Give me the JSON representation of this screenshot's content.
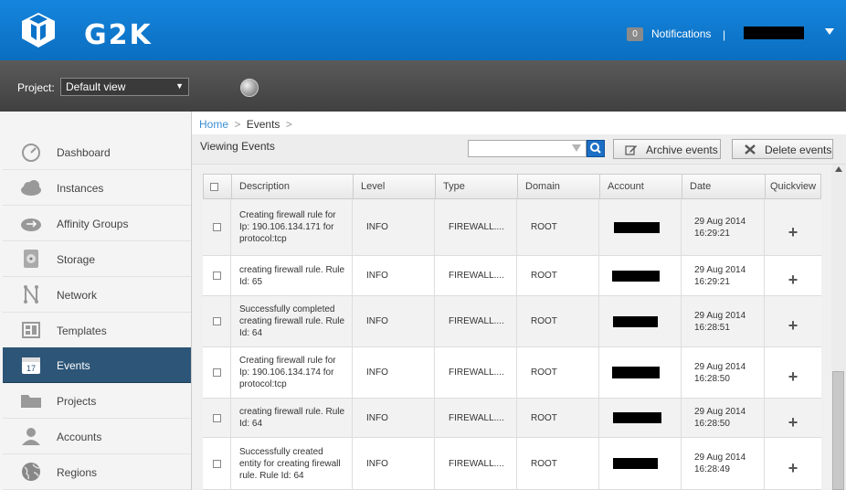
{
  "header": {
    "logo_text": "G2K",
    "notifications_count": "0",
    "notifications_label": "Notifications",
    "separator": "|"
  },
  "project_bar": {
    "label": "Project:",
    "selected": "Default view"
  },
  "sidebar": {
    "items": [
      {
        "label": "Dashboard",
        "icon": "dashboard-icon"
      },
      {
        "label": "Instances",
        "icon": "cloud-icon"
      },
      {
        "label": "Affinity Groups",
        "icon": "affinity-icon"
      },
      {
        "label": "Storage",
        "icon": "storage-icon"
      },
      {
        "label": "Network",
        "icon": "network-icon"
      },
      {
        "label": "Templates",
        "icon": "templates-icon"
      },
      {
        "label": "Events",
        "icon": "calendar-icon",
        "active": true,
        "badge": "17"
      },
      {
        "label": "Projects",
        "icon": "folder-icon"
      },
      {
        "label": "Accounts",
        "icon": "user-icon"
      },
      {
        "label": "Regions",
        "icon": "globe-icon"
      }
    ]
  },
  "breadcrumb": {
    "home": "Home",
    "sep1": ">",
    "current": "Events",
    "sep2": ">"
  },
  "toolbar": {
    "title": "Viewing Events",
    "archive_label": "Archive events",
    "delete_label": "Delete events"
  },
  "table": {
    "columns": [
      "Description",
      "Level",
      "Type",
      "Domain",
      "Account",
      "Date",
      "Quickview"
    ],
    "rows": [
      {
        "description": "Creating firewall rule for Ip: 190.106.134.171 for protocol:tcp",
        "level": "INFO",
        "type": "FIREWALL....",
        "domain": "ROOT",
        "date": "29 Aug 2014 16:29:21"
      },
      {
        "description": "creating firewall rule. Rule Id: 65",
        "level": "INFO",
        "type": "FIREWALL....",
        "domain": "ROOT",
        "date": "29 Aug 2014 16:29:21"
      },
      {
        "description": "Successfully completed creating firewall rule. Rule Id: 64",
        "level": "INFO",
        "type": "FIREWALL....",
        "domain": "ROOT",
        "date": "29 Aug 2014 16:28:51"
      },
      {
        "description": "Creating firewall rule for Ip: 190.106.134.174 for protocol:tcp",
        "level": "INFO",
        "type": "FIREWALL....",
        "domain": "ROOT",
        "date": "29 Aug 2014 16:28:50"
      },
      {
        "description": "creating firewall rule. Rule Id: 64",
        "level": "INFO",
        "type": "FIREWALL....",
        "domain": "ROOT",
        "date": "29 Aug 2014 16:28:50"
      },
      {
        "description": "Successfully created entity for creating firewall rule. Rule Id: 64",
        "level": "INFO",
        "type": "FIREWALL....",
        "domain": "ROOT",
        "date": "29 Aug 2014 16:28:49"
      }
    ]
  },
  "colors": {
    "header_blue": "#0b73c9",
    "active_nav": "#2c5577",
    "link_blue": "#3a8fd3"
  }
}
